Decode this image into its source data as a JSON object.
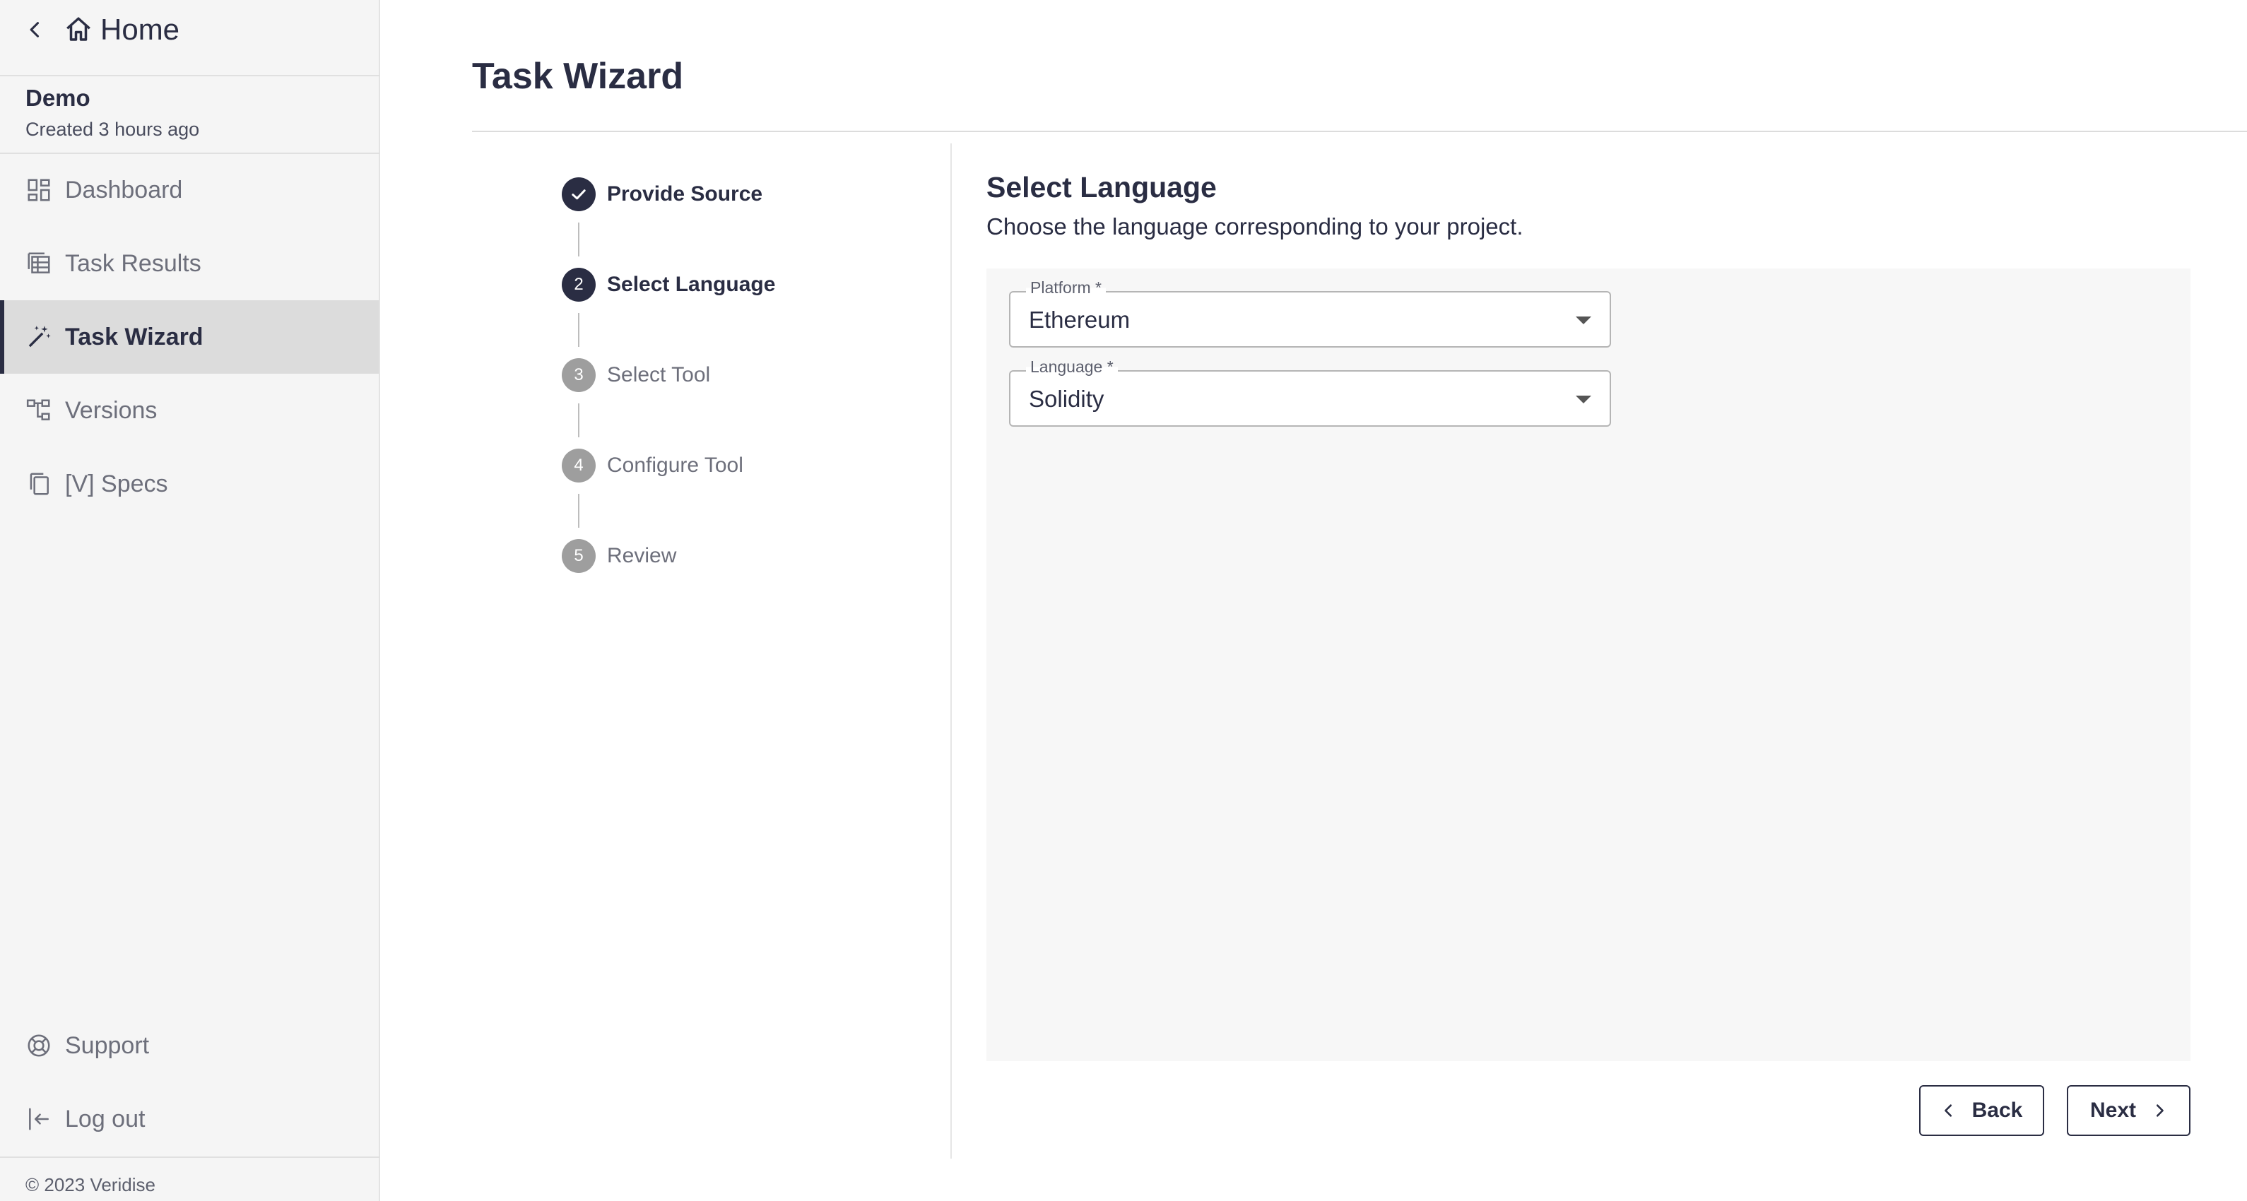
{
  "sidebar": {
    "home_label": "Home",
    "project_name": "Demo",
    "project_created": "Created 3 hours ago",
    "items": [
      {
        "label": "Dashboard",
        "icon": "dashboard-icon"
      },
      {
        "label": "Task Results",
        "icon": "table-icon"
      },
      {
        "label": "Task Wizard",
        "icon": "magic-wand-icon",
        "active": true
      },
      {
        "label": "Versions",
        "icon": "tree-icon"
      },
      {
        "label": "[V] Specs",
        "icon": "copy-icon"
      }
    ],
    "bottom_items": [
      {
        "label": "Support",
        "icon": "lifebuoy-icon"
      },
      {
        "label": "Log out",
        "icon": "logout-icon"
      }
    ],
    "copyright": "© 2023 Veridise"
  },
  "main": {
    "title": "Task Wizard",
    "steps": [
      {
        "number": "",
        "label": "Provide Source",
        "state": "completed"
      },
      {
        "number": "2",
        "label": "Select Language",
        "state": "active"
      },
      {
        "number": "3",
        "label": "Select Tool",
        "state": "pending"
      },
      {
        "number": "4",
        "label": "Configure Tool",
        "state": "pending"
      },
      {
        "number": "5",
        "label": "Review",
        "state": "pending"
      }
    ],
    "section": {
      "title": "Select Language",
      "description": "Choose the language corresponding to your project."
    },
    "form": {
      "platform": {
        "label": "Platform *",
        "value": "Ethereum"
      },
      "language": {
        "label": "Language *",
        "value": "Solidity"
      }
    },
    "buttons": {
      "back_label": "Back",
      "next_label": "Next"
    }
  },
  "colors": {
    "primary": "#2a2d43",
    "sidebar_bg": "#f5f5f5",
    "active_item_bg": "#dcdcdc",
    "step_pending": "#9e9e9e",
    "panel_bg": "#f7f7f7"
  }
}
